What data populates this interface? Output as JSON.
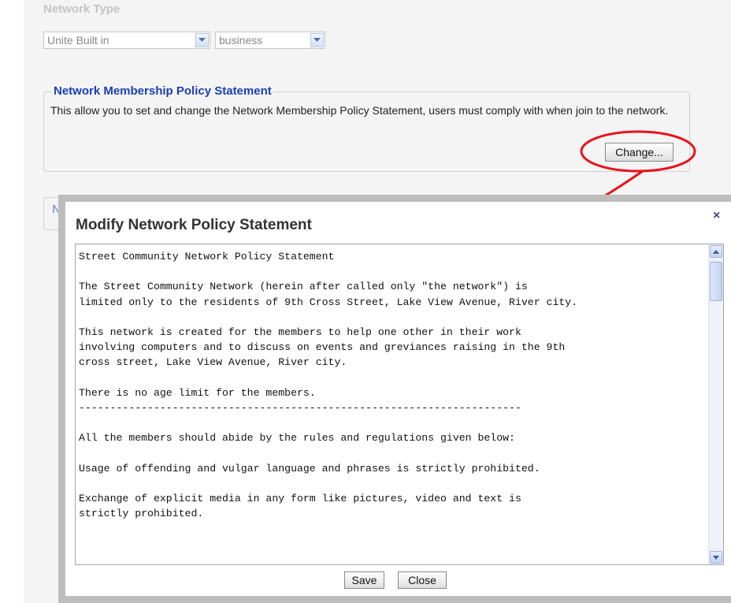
{
  "network_type": {
    "label": "Network Type",
    "selects": [
      {
        "value": "Unite Built in"
      },
      {
        "value": "business"
      }
    ]
  },
  "membership_policy": {
    "legend": "Network Membership Policy Statement",
    "description": "This allow you to set and change the Network Membership Policy Statement, users must comply with when join to the network.",
    "change_button": "Change..."
  },
  "hidden_section": {
    "legend_partial": "N"
  },
  "modal": {
    "title": "Modify Network Policy Statement",
    "close_symbol": "×",
    "policy_text": "Street Community Network Policy Statement\n\nThe Street Community Network (herein after called only \"the network\") is\nlimited only to the residents of 9th Cross Street, Lake View Avenue, River city.\n\nThis network is created for the members to help one other in their work\ninvolving computers and to discuss on events and greviances raising in the 9th\ncross street, Lake View Avenue, River city.\n\nThere is no age limit for the members.\n-----------------------------------------------------------------------\n\nAll the members should abide by the rules and regulations given below:\n\nUsage of offending and vulgar language and phrases is strictly prohibited.\n\nExchange of explicit media in any form like pictures, video and text is\nstrictly prohibited.",
    "save_button": "Save",
    "close_button": "Close"
  },
  "annotation": {
    "highlight_color": "#e8121b"
  }
}
